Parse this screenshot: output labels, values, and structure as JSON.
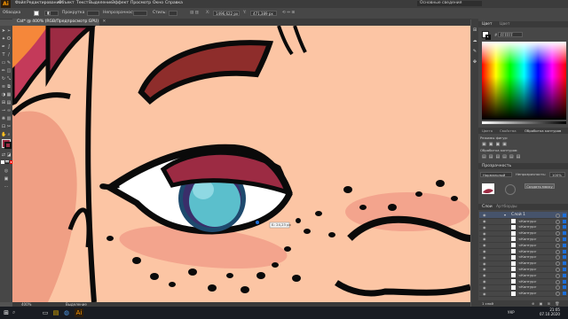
{
  "app": {
    "logo": "Ai",
    "menus": [
      "Файл",
      "Редактирование",
      "Объект",
      "Текст",
      "Выделение",
      "Эффект",
      "Просмотр",
      "Окно",
      "Справка"
    ],
    "workspace": "Основные сведения",
    "window_controls": [
      "—",
      "❐",
      "✕"
    ]
  },
  "control_bar": {
    "left_label": "Обводка",
    "stroke_label": "Прокрутка",
    "opacity_label": "Непрозрачность",
    "style_label": "Стиль:",
    "x_value": "1496,622 px",
    "y_value": "471,389 px"
  },
  "document_tab": {
    "label": "Cat* @ 400% (RGB/Предпросмотр GPU)",
    "close": "✕"
  },
  "canvas": {
    "tooltip": "Б: 24,23 px"
  },
  "color_panel": {
    "tab1": "Цвет",
    "tab2": "Цвет",
    "hex": "FFFFFF"
  },
  "pathfinder_panel": {
    "tabs": [
      "Цвета",
      "Свойства",
      "Обработка контуров"
    ],
    "shape_modes_label": "Режимы фигур:",
    "pathfinder_label": "Обработка контуров:"
  },
  "transparency_panel": {
    "title": "Прозрачность",
    "mode": "Нормальный",
    "opacity_label": "Непрозрачность:",
    "opacity_value": "100%",
    "make_mask": "Создать маску"
  },
  "layers_panel": {
    "tabs": [
      "Слои",
      "Артборды"
    ],
    "parent_layer": "Слой 1",
    "sublayers": [
      "<Контур>",
      "<Контур>",
      "<Контур>",
      "<Контур>",
      "<Контур>",
      "<Контур>",
      "<Контур>",
      "<Контур>",
      "<Контур>",
      "<Контур>",
      "<Контур>",
      "<Контур>",
      "<Контур>"
    ],
    "footer": "1 слой"
  },
  "status_bar": {
    "zoom": "400%",
    "tool": "Выделение"
  },
  "taskbar": {
    "search_placeholder": "",
    "time": "21:05",
    "date": "07.10.2020",
    "lang": "УКР"
  },
  "colors": {
    "skin": "#fcc5a4",
    "outline": "#0a0a0a",
    "eyelid": "#9c2b43",
    "iris": "#5bbfcc",
    "iris_dark": "#1e4a6e",
    "hair": "#c43a5a",
    "blush": "#f3a48d",
    "brow": "#8e2d2b"
  }
}
